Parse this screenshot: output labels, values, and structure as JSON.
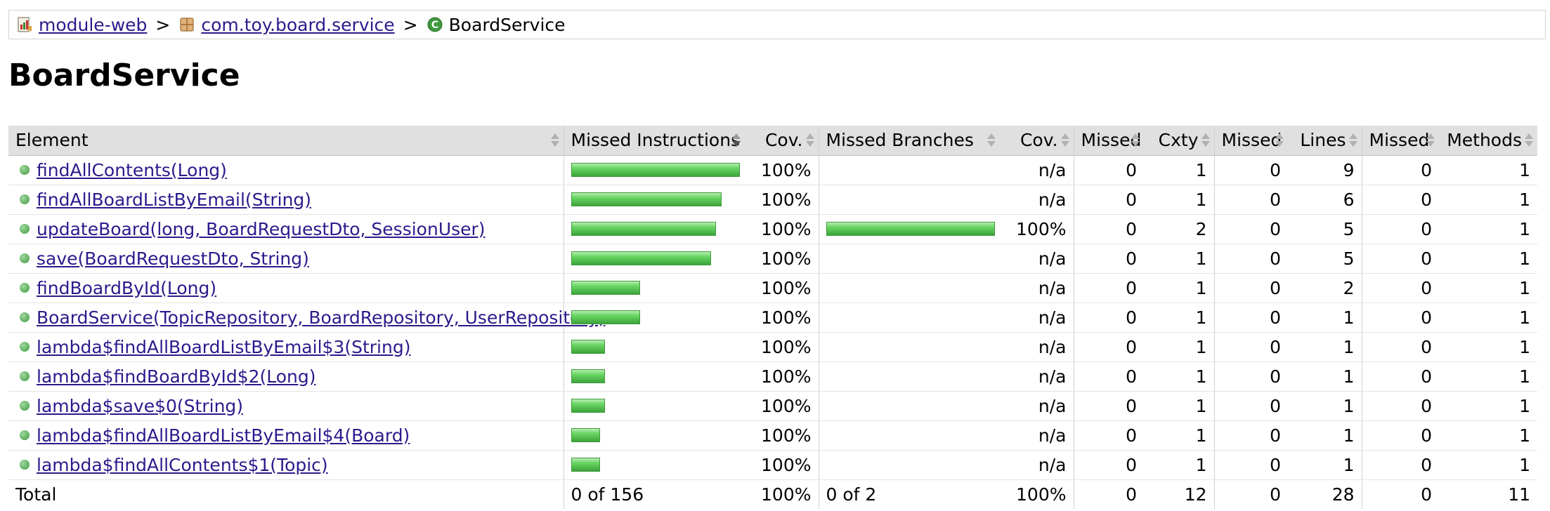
{
  "breadcrumb": {
    "items": [
      {
        "label": "module-web",
        "icon": "report-icon"
      },
      {
        "label": "com.toy.board.service",
        "icon": "package-icon"
      },
      {
        "label": "BoardService",
        "icon": "class-icon"
      }
    ],
    "separator": ">"
  },
  "page_title": "BoardService",
  "table": {
    "headers": {
      "element": "Element",
      "missed_instructions": "Missed Instructions",
      "cov_instructions": "Cov.",
      "missed_branches": "Missed Branches",
      "cov_branches": "Cov.",
      "missed_cxty": "Missed",
      "cxty": "Cxty",
      "missed_lines": "Missed",
      "lines": "Lines",
      "missed_methods": "Missed",
      "methods": "Methods"
    },
    "rows": [
      {
        "element": "findAllContents(Long)",
        "instr_fraction": 1.0,
        "instr_cov": "100%",
        "branch_fraction": null,
        "branch_cov": "n/a",
        "missed_cxty": "0",
        "cxty": "1",
        "missed_lines": "0",
        "lines": "9",
        "missed_methods": "0",
        "methods": "1"
      },
      {
        "element": "findAllBoardListByEmail(String)",
        "instr_fraction": 0.89,
        "instr_cov": "100%",
        "branch_fraction": null,
        "branch_cov": "n/a",
        "missed_cxty": "0",
        "cxty": "1",
        "missed_lines": "0",
        "lines": "6",
        "missed_methods": "0",
        "methods": "1"
      },
      {
        "element": "updateBoard(long, BoardRequestDto, SessionUser)",
        "instr_fraction": 0.86,
        "instr_cov": "100%",
        "branch_fraction": 1.0,
        "branch_cov": "100%",
        "missed_cxty": "0",
        "cxty": "2",
        "missed_lines": "0",
        "lines": "5",
        "missed_methods": "0",
        "methods": "1"
      },
      {
        "element": "save(BoardRequestDto, String)",
        "instr_fraction": 0.83,
        "instr_cov": "100%",
        "branch_fraction": null,
        "branch_cov": "n/a",
        "missed_cxty": "0",
        "cxty": "1",
        "missed_lines": "0",
        "lines": "5",
        "missed_methods": "0",
        "methods": "1"
      },
      {
        "element": "findBoardById(Long)",
        "instr_fraction": 0.41,
        "instr_cov": "100%",
        "branch_fraction": null,
        "branch_cov": "n/a",
        "missed_cxty": "0",
        "cxty": "1",
        "missed_lines": "0",
        "lines": "2",
        "missed_methods": "0",
        "methods": "1"
      },
      {
        "element": "BoardService(TopicRepository, BoardRepository, UserRepository)",
        "instr_fraction": 0.41,
        "instr_cov": "100%",
        "branch_fraction": null,
        "branch_cov": "n/a",
        "missed_cxty": "0",
        "cxty": "1",
        "missed_lines": "0",
        "lines": "1",
        "missed_methods": "0",
        "methods": "1"
      },
      {
        "element": "lambda$findAllBoardListByEmail$3(String)",
        "instr_fraction": 0.2,
        "instr_cov": "100%",
        "branch_fraction": null,
        "branch_cov": "n/a",
        "missed_cxty": "0",
        "cxty": "1",
        "missed_lines": "0",
        "lines": "1",
        "missed_methods": "0",
        "methods": "1"
      },
      {
        "element": "lambda$findBoardById$2(Long)",
        "instr_fraction": 0.2,
        "instr_cov": "100%",
        "branch_fraction": null,
        "branch_cov": "n/a",
        "missed_cxty": "0",
        "cxty": "1",
        "missed_lines": "0",
        "lines": "1",
        "missed_methods": "0",
        "methods": "1"
      },
      {
        "element": "lambda$save$0(String)",
        "instr_fraction": 0.2,
        "instr_cov": "100%",
        "branch_fraction": null,
        "branch_cov": "n/a",
        "missed_cxty": "0",
        "cxty": "1",
        "missed_lines": "0",
        "lines": "1",
        "missed_methods": "0",
        "methods": "1"
      },
      {
        "element": "lambda$findAllBoardListByEmail$4(Board)",
        "instr_fraction": 0.17,
        "instr_cov": "100%",
        "branch_fraction": null,
        "branch_cov": "n/a",
        "missed_cxty": "0",
        "cxty": "1",
        "missed_lines": "0",
        "lines": "1",
        "missed_methods": "0",
        "methods": "1"
      },
      {
        "element": "lambda$findAllContents$1(Topic)",
        "instr_fraction": 0.17,
        "instr_cov": "100%",
        "branch_fraction": null,
        "branch_cov": "n/a",
        "missed_cxty": "0",
        "cxty": "1",
        "missed_lines": "0",
        "lines": "1",
        "missed_methods": "0",
        "methods": "1"
      }
    ],
    "total": {
      "label": "Total",
      "missed_instructions": "0 of 156",
      "instr_cov": "100%",
      "missed_branches": "0 of 2",
      "branch_cov": "100%",
      "missed_cxty": "0",
      "cxty": "12",
      "missed_lines": "0",
      "lines": "28",
      "missed_methods": "0",
      "methods": "11"
    }
  },
  "colors": {
    "link": "#2a1b8c",
    "bar_green": "#3ca33a",
    "header_bg": "#e0e0e0"
  }
}
